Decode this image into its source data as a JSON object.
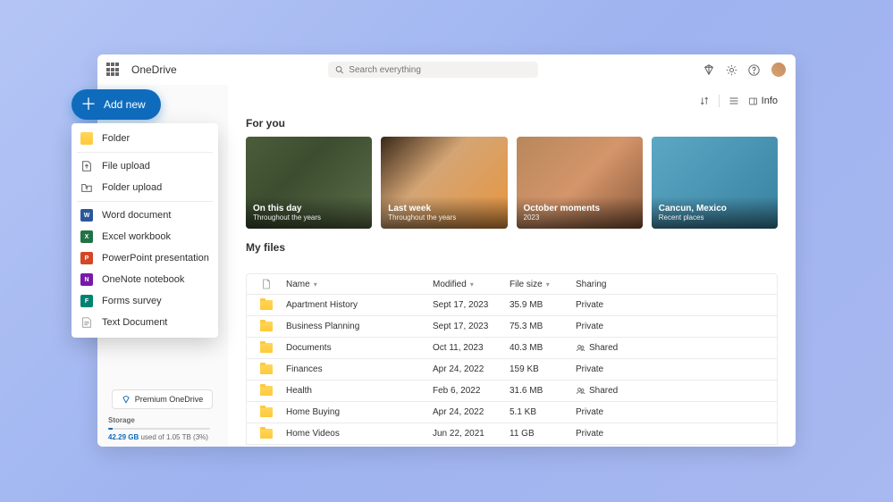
{
  "header": {
    "app_name": "OneDrive",
    "search_placeholder": "Search everything"
  },
  "toolbar": {
    "info_label": "Info"
  },
  "add_new": {
    "label": "Add new",
    "items": [
      {
        "label": "Folder",
        "icon": "folder"
      },
      {
        "label": "File upload",
        "icon": "file-upload"
      },
      {
        "label": "Folder upload",
        "icon": "folder-upload"
      },
      {
        "label": "Word document",
        "icon": "word"
      },
      {
        "label": "Excel workbook",
        "icon": "excel"
      },
      {
        "label": "PowerPoint presentation",
        "icon": "powerpoint"
      },
      {
        "label": "OneNote notebook",
        "icon": "onenote"
      },
      {
        "label": "Forms survey",
        "icon": "forms"
      },
      {
        "label": "Text Document",
        "icon": "text"
      }
    ]
  },
  "sections": {
    "for_you": "For you",
    "my_files": "My files"
  },
  "for_you_cards": [
    {
      "title": "On this day",
      "subtitle": "Throughout the years"
    },
    {
      "title": "Last week",
      "subtitle": "Throughout the years"
    },
    {
      "title": "October moments",
      "subtitle": "2023"
    },
    {
      "title": "Cancun, Mexico",
      "subtitle": "Recent places"
    }
  ],
  "table": {
    "columns": {
      "name": "Name",
      "modified": "Modified",
      "size": "File size",
      "sharing": "Sharing"
    },
    "rows": [
      {
        "name": "Apartment History",
        "modified": "Sept 17, 2023",
        "size": "35.9 MB",
        "sharing": "Private",
        "shared_icon": false
      },
      {
        "name": "Business Planning",
        "modified": "Sept 17, 2023",
        "size": "75.3 MB",
        "sharing": "Private",
        "shared_icon": false
      },
      {
        "name": "Documents",
        "modified": "Oct 11, 2023",
        "size": "40.3 MB",
        "sharing": "Shared",
        "shared_icon": true
      },
      {
        "name": "Finances",
        "modified": "Apr 24, 2022",
        "size": "159 KB",
        "sharing": "Private",
        "shared_icon": false
      },
      {
        "name": "Health",
        "modified": "Feb 6, 2022",
        "size": "31.6 MB",
        "sharing": "Shared",
        "shared_icon": true
      },
      {
        "name": "Home Buying",
        "modified": "Apr 24, 2022",
        "size": "5.1 KB",
        "sharing": "Private",
        "shared_icon": false
      },
      {
        "name": "Home Videos",
        "modified": "Jun 22, 2021",
        "size": "11 GB",
        "sharing": "Private",
        "shared_icon": false
      }
    ]
  },
  "premium": {
    "label": "Premium OneDrive"
  },
  "storage": {
    "label": "Storage",
    "used": "42.29 GB",
    "text_suffix": " used of 1.05 TB (3%)",
    "percent": 3
  },
  "colors": {
    "primary": "#0f6cbd",
    "folder": "#ffc93c"
  }
}
